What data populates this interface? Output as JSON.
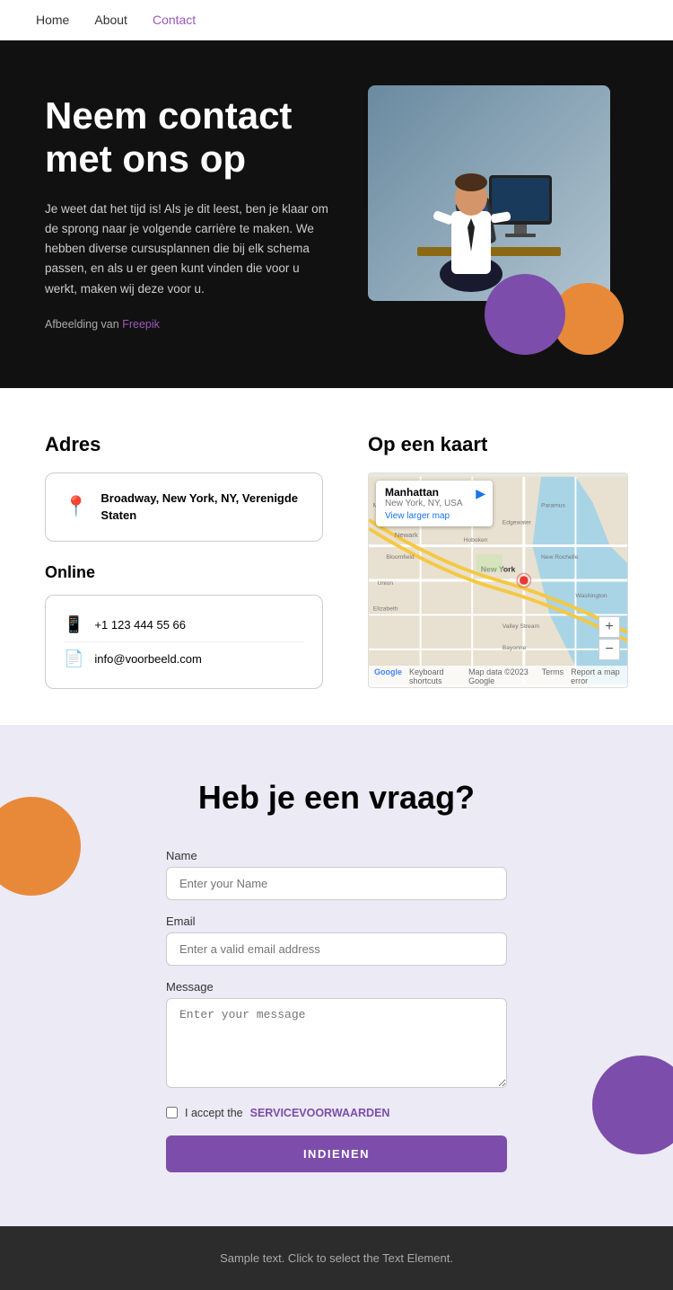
{
  "nav": {
    "links": [
      {
        "label": "Home",
        "href": "#",
        "active": false
      },
      {
        "label": "About",
        "href": "#",
        "active": false
      },
      {
        "label": "Contact",
        "href": "#",
        "active": true
      }
    ]
  },
  "hero": {
    "title_line1": "Neem contact",
    "title_line2": "met ons op",
    "body": "Je weet dat het tijd is! Als je dit leest, ben je klaar om de sprong naar je volgende carrière te maken. We hebben diverse cursusplannen die bij elk schema passen, en als u er geen kunt vinden die voor u werkt, maken wij deze voor u.",
    "credit_prefix": "Afbeelding van ",
    "credit_link": "Freepik",
    "credit_url": "#"
  },
  "address": {
    "heading": "Adres",
    "address_text": "Broadway, New York, NY, Verenigde Staten",
    "online_heading": "Online",
    "phone": "+1 123 444 55 66",
    "email": "info@voorbeeld.com"
  },
  "map": {
    "heading": "Op een kaart",
    "place_name": "Manhattan",
    "place_sub": "New York, NY, USA",
    "view_link": "View larger map",
    "directions": "Directions",
    "footer_items": [
      "Keyboard shortcuts",
      "Map data ©2023 Google",
      "Terms",
      "Report a map error"
    ]
  },
  "form": {
    "heading": "Heb je een vraag?",
    "name_label": "Name",
    "name_placeholder": "Enter your Name",
    "email_label": "Email",
    "email_placeholder": "Enter a valid email address",
    "message_label": "Message",
    "message_placeholder": "Enter your message",
    "checkbox_text": "I accept the ",
    "terms_link": "SERVICEVOORWAARDEN",
    "submit_label": "INDIENEN"
  },
  "footer": {
    "text": "Sample text. Click to select the Text Element."
  }
}
